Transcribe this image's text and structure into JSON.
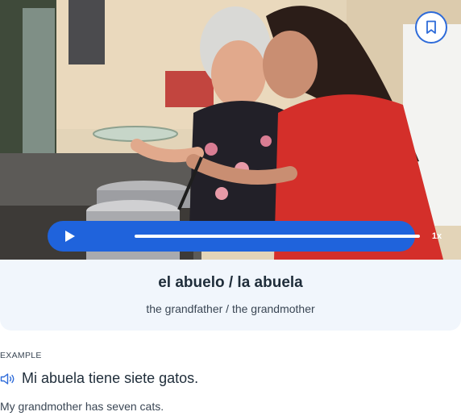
{
  "flashcard": {
    "image_alt": "grandmother and granddaughter cooking together in a kitchen",
    "word": "el abuelo / la abuela",
    "translation": "the grandfather / the grandmother",
    "bookmark_icon": "bookmark-icon",
    "audio_player": {
      "play_icon": "play-icon",
      "progress": 0,
      "speed_label": "1x"
    }
  },
  "example": {
    "label": "EXAMPLE",
    "speaker_icon": "speaker-icon",
    "sentence": "Mi abuela tiene siete gatos.",
    "translation": "My grandmother has seven cats."
  },
  "colors": {
    "accent": "#1f63dc",
    "card_background": "#f1f6fc",
    "text": "#1f2d3a"
  }
}
